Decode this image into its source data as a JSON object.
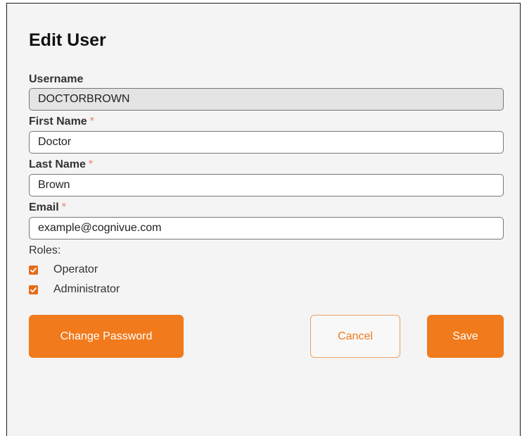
{
  "dialog": {
    "title": "Edit User",
    "fields": {
      "username": {
        "label": "Username",
        "value": "DOCTORBROWN",
        "readonly": true
      },
      "first_name": {
        "label": "First Name",
        "required_mark": "*",
        "value": "Doctor"
      },
      "last_name": {
        "label": "Last Name",
        "required_mark": "*",
        "value": "Brown"
      },
      "email": {
        "label": "Email",
        "required_mark": "*",
        "value": "example@cognivue.com"
      }
    },
    "roles": {
      "label": "Roles:",
      "options": [
        {
          "label": "Operator",
          "checked": true
        },
        {
          "label": "Administrator",
          "checked": true
        }
      ]
    },
    "buttons": {
      "change_password": "Change Password",
      "cancel": "Cancel",
      "save": "Save"
    },
    "colors": {
      "accent": "#f07a1c",
      "required": "#e8826a",
      "panel_bg": "#f4f4f4"
    }
  }
}
